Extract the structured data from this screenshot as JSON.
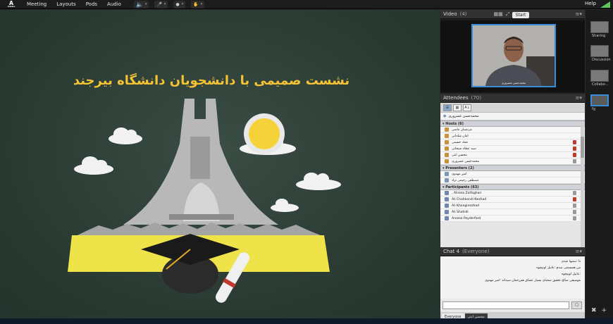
{
  "menubar": {
    "logo_text": "A",
    "logo_sub": "Adobe",
    "items": [
      "Meeting",
      "Layouts",
      "Pods",
      "Audio"
    ],
    "help": "Help"
  },
  "stage": {
    "slide_title": "نشست صمیمی با دانشجویان دانشگاه بیرجند"
  },
  "video_pod": {
    "title": "Video",
    "count": "(4)",
    "start_label": "Start",
    "presenter_name": "محمدحسن عسروری"
  },
  "attendees_pod": {
    "title": "Attendees",
    "count": "(70)",
    "me": "محمدحسن عسروری",
    "hosts_label": "Hosts (6)",
    "hosts": [
      "مرتضیان ماسی",
      "امان شلدانی",
      "عماد حسینی",
      "سید عطاء شیخانی",
      "محسن ابتی",
      "محمدحسن عسروری"
    ],
    "presenters_label": "Presenters (2)",
    "presenters": [
      "امیر مهدوی",
      "مصطفی رحیمی نژاد"
    ],
    "participants_label": "Participants (63)",
    "participants": [
      ". Alireza Zolfaghari",
      "Ali Chahkandi Nezhad",
      "Ali Khonginezhad",
      "Ali Shahidi",
      "Arezoo Payderfard"
    ]
  },
  "chat_pod": {
    "title": "Chat 4",
    "scope": "(Everyone)",
    "messages": [
      "دا :ستیها عیدی",
      "من همسمتی ضدم :عابیل لونیچوه",
      ":عابیل لونیچوه",
      "موسیقی صالح تخفیق صحبای بسیار عشاق هم‌رحمان سیدانه :امیر مهدوی"
    ],
    "tabs": [
      "Everyone",
      "محسن ابتی"
    ]
  },
  "layouts": {
    "items": [
      "Sharing",
      "Discussion",
      "Collabo...",
      "fg"
    ]
  }
}
